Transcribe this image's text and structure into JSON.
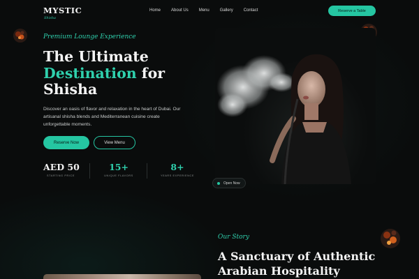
{
  "nav": {
    "logo": "MYSTIC",
    "logo_sub": "Shisha",
    "links": [
      "Home",
      "About Us",
      "Menu",
      "Gallery",
      "Contact"
    ],
    "cta": "Reserve a Table"
  },
  "hero": {
    "eyebrow": "Premium Lounge Experience",
    "title_line1": "The Ultimate",
    "title_accent": "Destination",
    "title_for": " for",
    "title_line3": "Shisha",
    "description": "Discover an oasis of flavor and relaxation in the heart of Dubai. Our artisanal shisha blends and Mediterranean cuisine create unforgettable moments.",
    "btn_primary": "Reserve Now",
    "btn_secondary": "View Menu",
    "open_badge": "Open Now"
  },
  "stats": [
    {
      "value": "AED 50",
      "label": "STARTING PRICE"
    },
    {
      "value": "15+",
      "label": "UNIQUE FLAVORS"
    },
    {
      "value": "8+",
      "label": "YEARS EXPERIENCE"
    }
  ],
  "story": {
    "eyebrow": "Our Story",
    "title_line1": "A Sanctuary of Authentic",
    "title_line2": "Arabian Hospitality"
  },
  "icons": {
    "coal": "burning-coal-icon",
    "status_dot": "status-dot-icon"
  },
  "colors": {
    "accent": "#25c6a2",
    "background": "#0a0c0c"
  }
}
